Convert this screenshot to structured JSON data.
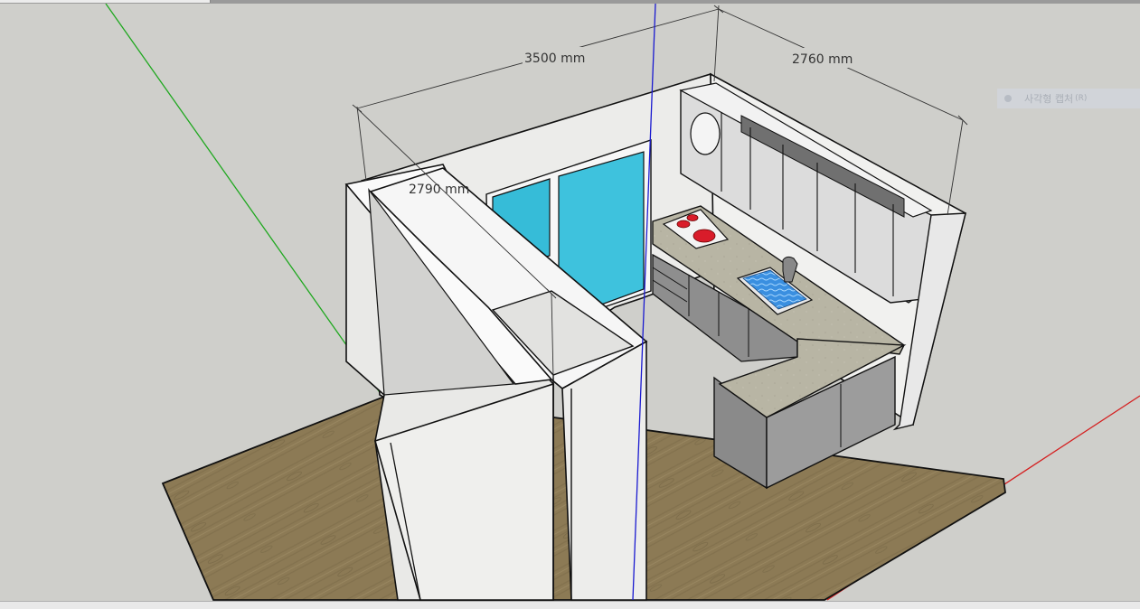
{
  "viewport": {
    "dimensions": [
      {
        "id": "width",
        "label": "3500 mm"
      },
      {
        "id": "depth",
        "label": "2760 mm"
      },
      {
        "id": "height",
        "label": "2790 mm"
      }
    ]
  },
  "overlay": {
    "capture_label": "사각형 캡처",
    "capture_shortcut": "(R)"
  },
  "colors": {
    "background": "#cfcfcb",
    "floor": "#8f7d59",
    "wall": "#f2f2f2",
    "window_glass": "#36bcd8",
    "cabinet": "#9a9a9a",
    "countertop": "#b9b6a6",
    "stove_burner": "#d91c2a",
    "sink_water": "#3a8fe0",
    "axis_red": "#d42020",
    "axis_green": "#1fa81f",
    "axis_blue": "#1a1ad0"
  }
}
